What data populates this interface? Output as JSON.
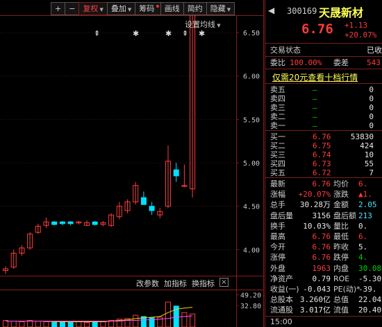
{
  "toolbar": {
    "buttons": [
      {
        "label": "+"
      },
      {
        "label": "−"
      },
      {
        "label": "复权"
      },
      {
        "label": "叠加"
      },
      {
        "label": "筹码"
      },
      {
        "label": "画线"
      },
      {
        "label": "简约"
      },
      {
        "label": "隐藏"
      }
    ]
  },
  "chart": {
    "settings_label": "设置均线",
    "markers": [
      "⇞",
      "✱",
      "✱",
      "⇞",
      "✱"
    ],
    "last_price_tag": "6.76",
    "axis_labels": [
      "6.50",
      "6.00",
      "5.50",
      "5.00",
      "4.50",
      "4.00"
    ],
    "indicator_toolbar": [
      "改参数",
      "加指标",
      "换指标"
    ],
    "indicator_close": "×",
    "volume_axis_labels": [
      "49.20",
      "32.80"
    ],
    "colors": {
      "up": "#ff3b3b",
      "down": "#00e0ff",
      "frame": "#8b1c1c",
      "grid": "#4a1414"
    }
  },
  "chart_data": {
    "type": "candlestick",
    "ylim": [
      3.7,
      6.7
    ],
    "yticks": [
      6.5,
      6.0,
      5.5,
      5.0,
      4.5,
      4.0
    ],
    "candles": [
      {
        "o": 3.76,
        "h": 3.81,
        "l": 3.72,
        "c": 3.78
      },
      {
        "o": 3.8,
        "h": 4.0,
        "l": 3.78,
        "c": 3.96
      },
      {
        "o": 3.96,
        "h": 4.05,
        "l": 3.93,
        "c": 4.02
      },
      {
        "o": 4.02,
        "h": 4.2,
        "l": 4.0,
        "c": 4.18
      },
      {
        "o": 4.2,
        "h": 4.3,
        "l": 4.18,
        "c": 4.27
      },
      {
        "o": 4.28,
        "h": 4.37,
        "l": 4.25,
        "c": 4.32
      },
      {
        "o": 4.32,
        "h": 4.33,
        "l": 4.28,
        "c": 4.29
      },
      {
        "o": 4.32,
        "h": 4.33,
        "l": 4.28,
        "c": 4.3
      },
      {
        "o": 4.32,
        "h": 4.33,
        "l": 4.28,
        "c": 4.3
      },
      {
        "o": 4.31,
        "h": 4.33,
        "l": 4.29,
        "c": 4.32
      },
      {
        "o": 4.28,
        "h": 4.34,
        "l": 4.27,
        "c": 4.31
      },
      {
        "o": 4.32,
        "h": 4.33,
        "l": 4.28,
        "c": 4.29
      },
      {
        "o": 4.29,
        "h": 4.33,
        "l": 4.27,
        "c": 4.31
      },
      {
        "o": 4.28,
        "h": 4.42,
        "l": 4.26,
        "c": 4.4
      },
      {
        "o": 4.38,
        "h": 4.55,
        "l": 4.35,
        "c": 4.5
      },
      {
        "o": 4.45,
        "h": 4.58,
        "l": 4.42,
        "c": 4.55
      },
      {
        "o": 4.55,
        "h": 4.78,
        "l": 4.52,
        "c": 4.74
      },
      {
        "o": 4.6,
        "h": 4.67,
        "l": 4.55,
        "c": 4.52
      },
      {
        "o": 4.5,
        "h": 4.55,
        "l": 4.4,
        "c": 4.45
      },
      {
        "o": 4.4,
        "h": 4.48,
        "l": 4.36,
        "c": 4.44
      },
      {
        "o": 4.5,
        "h": 5.2,
        "l": 4.48,
        "c": 5.02
      },
      {
        "o": 4.92,
        "h": 5.0,
        "l": 4.78,
        "c": 4.85
      },
      {
        "o": 4.74,
        "h": 4.98,
        "l": 4.72,
        "c": 4.74
      },
      {
        "o": 4.7,
        "h": 6.76,
        "l": 4.6,
        "c": 6.76
      }
    ],
    "volume": {
      "ylim": [
        0,
        55
      ],
      "values": [
        10,
        9,
        8,
        10,
        9,
        8,
        7,
        8,
        7,
        8,
        7,
        8,
        8,
        10,
        12,
        13,
        18,
        16,
        14,
        15,
        38,
        32,
        22,
        20
      ],
      "ma_lines": [
        {
          "color": "#ffd200",
          "values": [
            9,
            9,
            9,
            9,
            9,
            9,
            8,
            8,
            8,
            8,
            8,
            8,
            8,
            9,
            10,
            11,
            13,
            14,
            15,
            16,
            22,
            27,
            29,
            30
          ]
        },
        {
          "color": "#ff55ff",
          "values": [
            9,
            9,
            9,
            9,
            9,
            9,
            9,
            9,
            9,
            9,
            9,
            9,
            9,
            9,
            9,
            10,
            10,
            11,
            11,
            12,
            13,
            15,
            16,
            17
          ]
        }
      ]
    }
  },
  "stock": {
    "nav": "◀",
    "code": "300169",
    "name": "天晟新材",
    "price": "6.76",
    "change": "+1.13",
    "change_pct": "+20.07%"
  },
  "panel": {
    "status_label": "交易状态",
    "status_value": "已收",
    "ratio_label": "委比",
    "ratio_value": "100.00%",
    "diff_label": "委差",
    "diff_value": "543",
    "link": "仅需20元查看十档行情",
    "asks": [
      {
        "label": "卖五",
        "price": "—",
        "vol": "0"
      },
      {
        "label": "卖四",
        "price": "—",
        "vol": "0"
      },
      {
        "label": "卖三",
        "price": "—",
        "vol": "0"
      },
      {
        "label": "卖二",
        "price": "—",
        "vol": "0"
      },
      {
        "label": "卖一",
        "price": "—",
        "vol": "0"
      }
    ],
    "bids": [
      {
        "label": "买一",
        "price": "6.76",
        "vol": "53830"
      },
      {
        "label": "买二",
        "price": "6.75",
        "vol": "424"
      },
      {
        "label": "买三",
        "price": "6.74",
        "vol": "10"
      },
      {
        "label": "买四",
        "price": "6.73",
        "vol": "55"
      },
      {
        "label": "买五",
        "price": "6.72",
        "vol": "7"
      }
    ],
    "quotes": [
      {
        "l1": "最新",
        "v1": "6.76",
        "c1": "red",
        "l2": "均价",
        "v2": "6.",
        "c2": "red"
      },
      {
        "l1": "涨幅",
        "v1": "+20.07%",
        "c1": "red",
        "l2": "涨跌",
        "v2": "▲1.",
        "c2": "red"
      },
      {
        "l1": "总手",
        "v1": "30.28万",
        "c1": "white",
        "l2": "金额",
        "v2": "2.05",
        "c2": "cyan"
      },
      {
        "l1": "盘后量",
        "v1": "3156",
        "c1": "white",
        "l2": "盘后额",
        "v2": "213",
        "c2": "cyan"
      },
      {
        "l1": "换手",
        "v1": "10.03%",
        "c1": "white",
        "l2": "量比",
        "v2": "0.",
        "c2": "white"
      },
      {
        "l1": "最高",
        "v1": "6.76",
        "c1": "red",
        "l2": "最低",
        "v2": "6.",
        "c2": "red"
      },
      {
        "l1": "今开",
        "v1": "6.76",
        "c1": "red",
        "l2": "昨收",
        "v2": "5.",
        "c2": "white"
      },
      {
        "l1": "涨停",
        "v1": "6.76",
        "c1": "red",
        "l2": "跌停",
        "v2": "4.",
        "c2": "green"
      },
      {
        "l1": "外盘",
        "v1": "1963",
        "c1": "red",
        "l2": "内盘",
        "v2": "30.08",
        "c2": "green"
      },
      {
        "l1": "净资产",
        "v1": "0.79",
        "c1": "white",
        "l2": "ROE",
        "v2": "-5.30",
        "c2": "white"
      },
      {
        "l1": "收益(一)",
        "v1": "-0.043",
        "c1": "white",
        "l2": "PE(动)*",
        "v2": "-39.",
        "c2": "white"
      },
      {
        "l1": "总股本",
        "v1": "3.260亿",
        "c1": "white",
        "l2": "总值",
        "v2": "22.04",
        "c2": "white"
      },
      {
        "l1": "流通股",
        "v1": "3.017亿",
        "c1": "white",
        "l2": "流值",
        "v2": "20.40",
        "c2": "white"
      },
      {
        "l1": "15:00",
        "v1": "",
        "c1": "white",
        "l2": "",
        "v2": "",
        "c2": "white"
      }
    ]
  }
}
